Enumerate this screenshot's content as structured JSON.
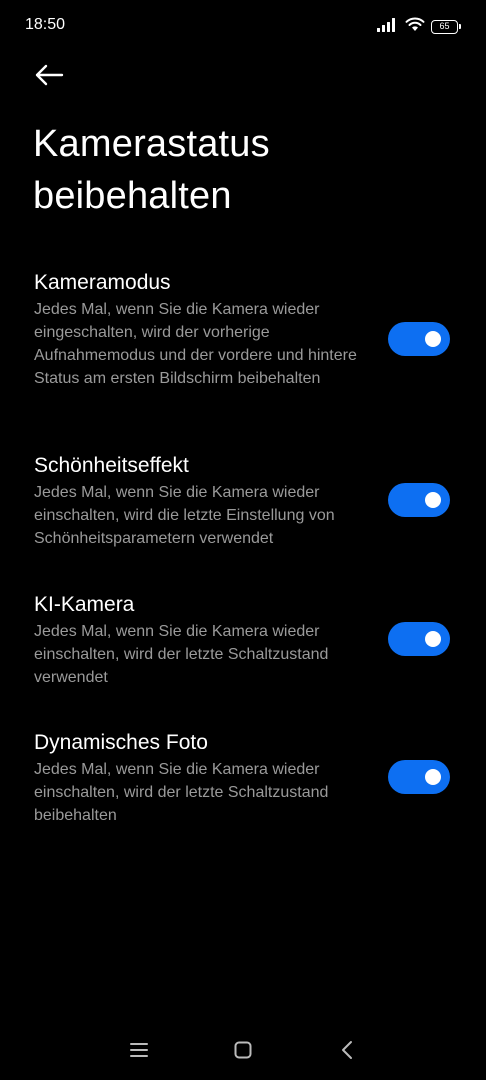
{
  "status_bar": {
    "time": "18:50",
    "battery_level": "65",
    "icons": [
      "signal-icon",
      "wifi-icon",
      "battery-icon"
    ]
  },
  "header": {
    "back_icon": "arrow-left-icon",
    "title": "Kamerastatus beibehalten"
  },
  "colors": {
    "background": "#000000",
    "toggle_on": "#0d6ff2",
    "description_text": "#9a9a9a"
  },
  "settings": [
    {
      "title": "Kameramodus",
      "description": "Jedes Mal, wenn Sie die Kamera wieder eingeschalten, wird der vorherige Aufnahmemodus und der vordere und hintere Status am ersten Bildschirm beibehalten",
      "enabled": true
    },
    {
      "title": "Schönheitseffekt",
      "description": "Jedes Mal, wenn Sie die Kamera wieder einschalten, wird die letzte Einstellung von Schönheitsparametern verwendet",
      "enabled": true
    },
    {
      "title": "KI-Kamera",
      "description": "Jedes Mal, wenn Sie die Kamera wieder einschalten, wird der letzte Schaltzustand verwendet",
      "enabled": true
    },
    {
      "title": "Dynamisches Foto",
      "description": "Jedes Mal, wenn Sie die Kamera wieder einschalten, wird der letzte Schaltzustand beibehalten",
      "enabled": true
    }
  ],
  "nav_bar": {
    "icons": [
      "menu-icon",
      "home-icon",
      "back-icon"
    ]
  }
}
